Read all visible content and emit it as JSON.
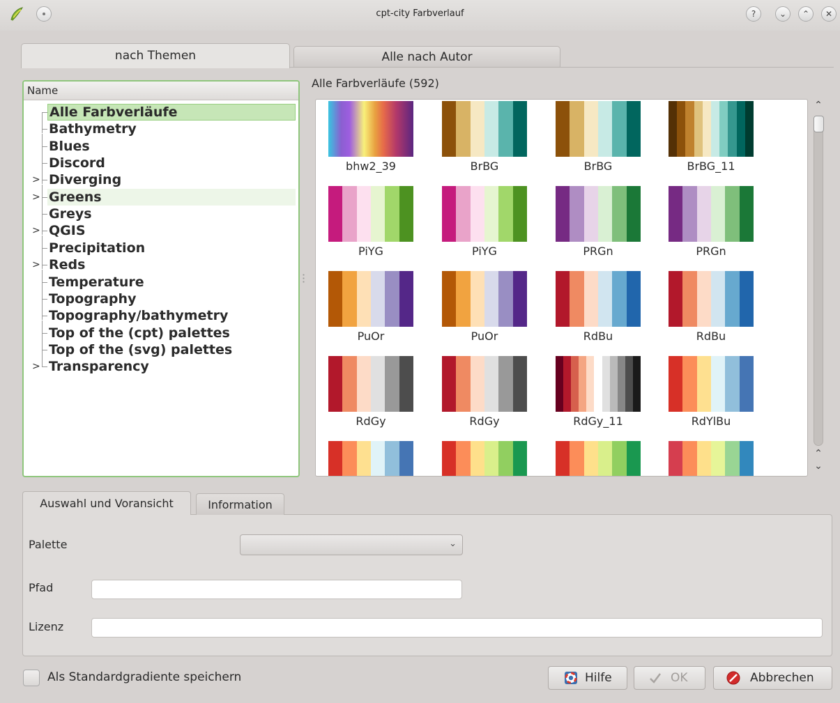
{
  "window": {
    "title": "cpt-city Farbverlauf"
  },
  "top_tabs": [
    {
      "label": "nach Themen"
    },
    {
      "label": "Alle nach Autor"
    }
  ],
  "tree": {
    "header": "Name",
    "items": [
      {
        "label": "Alle Farbverläufe",
        "expandable": false
      },
      {
        "label": "Bathymetry",
        "expandable": false
      },
      {
        "label": "Blues",
        "expandable": false
      },
      {
        "label": "Discord",
        "expandable": false
      },
      {
        "label": "Diverging",
        "expandable": true
      },
      {
        "label": "Greens",
        "expandable": true
      },
      {
        "label": "Greys",
        "expandable": false
      },
      {
        "label": "QGIS",
        "expandable": true
      },
      {
        "label": "Precipitation",
        "expandable": false
      },
      {
        "label": "Reds",
        "expandable": true
      },
      {
        "label": "Temperature",
        "expandable": false
      },
      {
        "label": "Topography",
        "expandable": false
      },
      {
        "label": "Topography/bathymetry",
        "expandable": false
      },
      {
        "label": "Top of the (cpt) palettes",
        "expandable": false
      },
      {
        "label": "Top of the (svg) palettes",
        "expandable": false
      },
      {
        "label": "Transparency",
        "expandable": true
      }
    ]
  },
  "gradients": {
    "heading": "Alle Farbverläufe (592)",
    "items": [
      {
        "name": "bhw2_39",
        "gradient": "linear-gradient(90deg,#39c5e0 0%,#8a5fd0 15%,#9e5ee0 25%,#f8f07a 42%,#e8a040 55%,#e66a4a 65%,#b2386a 80%,#5a2680 100%)"
      },
      {
        "name": "BrBG",
        "colors": [
          "#8c510a",
          "#d8b365",
          "#f6e8c3",
          "#c7eae5",
          "#5ab4ac",
          "#01665e"
        ]
      },
      {
        "name": "BrBG",
        "colors": [
          "#8c510a",
          "#d8b365",
          "#f6e8c3",
          "#c7eae5",
          "#5ab4ac",
          "#01665e"
        ]
      },
      {
        "name": "BrBG_11",
        "colors": [
          "#543005",
          "#8c510a",
          "#bf812d",
          "#dfc27d",
          "#f6e8c3",
          "#c7eae5",
          "#80cdc1",
          "#35978f",
          "#01665e",
          "#003c30"
        ]
      },
      {
        "name": "PiYG",
        "colors": [
          "#c51b7d",
          "#e9a3c9",
          "#fde0ef",
          "#e6f5d0",
          "#a1d76a",
          "#4d9221"
        ]
      },
      {
        "name": "PiYG",
        "colors": [
          "#c51b7d",
          "#e9a3c9",
          "#fde0ef",
          "#e6f5d0",
          "#a1d76a",
          "#4d9221"
        ]
      },
      {
        "name": "PRGn",
        "colors": [
          "#762a83",
          "#af8dc3",
          "#e7d4e8",
          "#d9f0d3",
          "#7fbf7b",
          "#1b7837"
        ]
      },
      {
        "name": "PRGn",
        "colors": [
          "#762a83",
          "#af8dc3",
          "#e7d4e8",
          "#d9f0d3",
          "#7fbf7b",
          "#1b7837"
        ]
      },
      {
        "name": "PuOr",
        "colors": [
          "#b35806",
          "#f1a340",
          "#fee0b6",
          "#d8daeb",
          "#998ec3",
          "#542788"
        ]
      },
      {
        "name": "PuOr",
        "colors": [
          "#b35806",
          "#f1a340",
          "#fee0b6",
          "#d8daeb",
          "#998ec3",
          "#542788"
        ]
      },
      {
        "name": "RdBu",
        "colors": [
          "#b2182b",
          "#ef8a62",
          "#fddbc7",
          "#d1e5f0",
          "#67a9cf",
          "#2166ac"
        ]
      },
      {
        "name": "RdBu",
        "colors": [
          "#b2182b",
          "#ef8a62",
          "#fddbc7",
          "#d1e5f0",
          "#67a9cf",
          "#2166ac"
        ]
      },
      {
        "name": "RdGy",
        "colors": [
          "#b2182b",
          "#ef8a62",
          "#fddbc7",
          "#e0e0e0",
          "#999999",
          "#4d4d4d"
        ]
      },
      {
        "name": "RdGy",
        "colors": [
          "#b2182b",
          "#ef8a62",
          "#fddbc7",
          "#e0e0e0",
          "#999999",
          "#4d4d4d"
        ]
      },
      {
        "name": "RdGy_11",
        "colors": [
          "#67001f",
          "#b2182b",
          "#d6604d",
          "#f4a582",
          "#fddbc7",
          "#ffffff",
          "#e0e0e0",
          "#bababa",
          "#878787",
          "#4d4d4d",
          "#1a1a1a"
        ]
      },
      {
        "name": "RdYlBu",
        "colors": [
          "#d73027",
          "#fc8d59",
          "#fee090",
          "#e0f3f8",
          "#91bfdb",
          "#4575b4"
        ]
      },
      {
        "name": "",
        "colors": [
          "#d73027",
          "#fc8d59",
          "#fee090",
          "#e0f3f8",
          "#91bfdb",
          "#4575b4"
        ]
      },
      {
        "name": "",
        "colors": [
          "#d73027",
          "#fc8d59",
          "#fee08b",
          "#d9ef8b",
          "#91cf60",
          "#1a9850"
        ]
      },
      {
        "name": "",
        "colors": [
          "#d73027",
          "#fc8d59",
          "#fee08b",
          "#d9ef8b",
          "#91cf60",
          "#1a9850"
        ]
      },
      {
        "name": "",
        "colors": [
          "#d53e4f",
          "#fc8d59",
          "#fee08b",
          "#e6f598",
          "#99d594",
          "#3288bd"
        ]
      }
    ]
  },
  "bottom_tabs": [
    {
      "label": "Auswahl und Voransicht"
    },
    {
      "label": "Information"
    }
  ],
  "form": {
    "palette_label": "Palette",
    "palette_value": "",
    "path_label": "Pfad",
    "path_value": "",
    "license_label": "Lizenz",
    "license_value": ""
  },
  "footer": {
    "checkbox_label": "Als Standardgradiente speichern",
    "checkbox_checked": false,
    "help_label": "Hilfe",
    "ok_label": "OK",
    "cancel_label": "Abbrechen"
  },
  "icons": {
    "app": "qgis-icon",
    "pin": "pin-icon",
    "help": "help-icon",
    "minimize": "minimize-icon",
    "maximize": "maximize-icon",
    "close": "close-icon",
    "scroll_up": "chevron-up-icon",
    "scroll_down": "chevron-down-icon",
    "dropdown": "chevron-down-icon",
    "lifebuoy": "lifebuoy-icon",
    "check": "check-icon",
    "stop": "stop-icon"
  },
  "colors": {
    "tree_border": "#8fc67d",
    "tree_selected": "#c6e6b7",
    "cancel_red": "#d22b2b"
  }
}
